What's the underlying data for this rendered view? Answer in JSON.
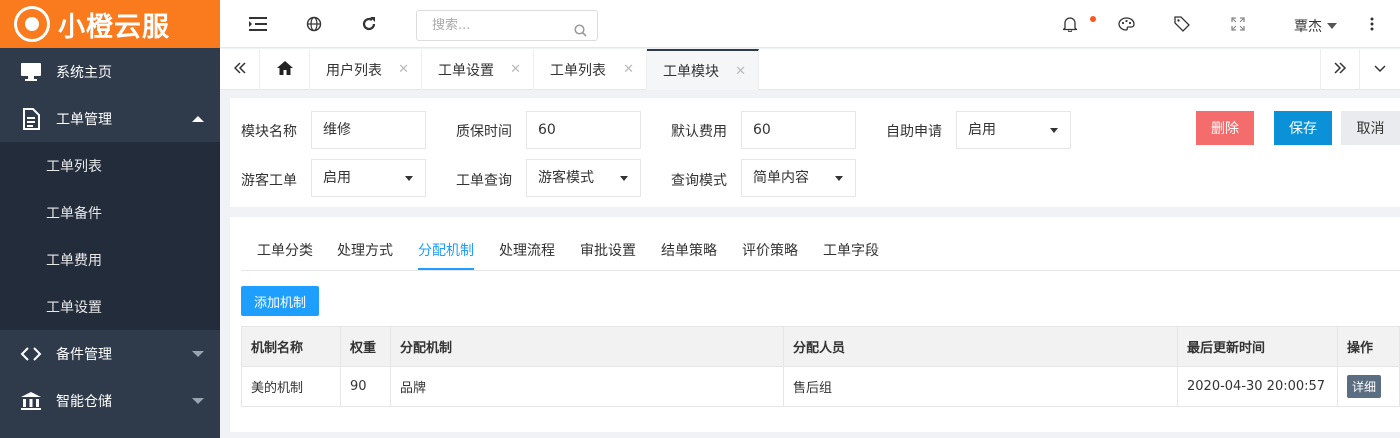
{
  "app": {
    "logo_text": "小橙云服"
  },
  "sidebar": {
    "items": [
      {
        "label": "系统主页",
        "icon": "monitor-icon"
      },
      {
        "label": "工单管理",
        "icon": "document-icon",
        "expanded": true,
        "children": [
          {
            "label": "工单列表"
          },
          {
            "label": "工单备件"
          },
          {
            "label": "工单费用"
          },
          {
            "label": "工单设置"
          }
        ]
      },
      {
        "label": "备件管理",
        "icon": "parts-icon"
      },
      {
        "label": "智能仓储",
        "icon": "warehouse-icon"
      }
    ]
  },
  "topbar": {
    "search_placeholder": "搜索...",
    "user_name": "覃杰",
    "icons": [
      "menu-toggle-icon",
      "globe-icon",
      "refresh-icon",
      "bell-icon",
      "palette-icon",
      "tag-icon",
      "fullscreen-icon",
      "more-vertical-icon"
    ]
  },
  "tabs": {
    "items": [
      {
        "label": "用户列表",
        "active": false
      },
      {
        "label": "工单设置",
        "active": false
      },
      {
        "label": "工单列表",
        "active": false
      },
      {
        "label": "工单模块",
        "active": true
      }
    ]
  },
  "form": {
    "module_name_label": "模块名称",
    "module_name_value": "维修",
    "warranty_label": "质保时间",
    "warranty_value": "60",
    "default_fee_label": "默认费用",
    "default_fee_value": "60",
    "self_apply_label": "自助申请",
    "self_apply_value": "启用",
    "guest_label": "游客工单",
    "guest_value": "启用",
    "query_label": "工单查询",
    "query_value": "游客模式",
    "query_mode_label": "查询模式",
    "query_mode_value": "简单内容",
    "delete_label": "删除",
    "save_label": "保存",
    "cancel_label": "取消"
  },
  "subtabs": {
    "items": [
      "工单分类",
      "处理方式",
      "分配机制",
      "处理流程",
      "审批设置",
      "结单策略",
      "评价策略",
      "工单字段"
    ],
    "active_index": 2
  },
  "table": {
    "add_label": "添加机制",
    "headers": [
      "机制名称",
      "权重",
      "分配机制",
      "分配人员",
      "最后更新时间",
      "操作"
    ],
    "rows": [
      {
        "name": "美的机制",
        "weight": "90",
        "mechanism": "品牌",
        "assignee": "售后组",
        "updated": "2020-04-30 20:00:57",
        "action": "详细"
      }
    ]
  },
  "colors": {
    "brand": "#fa7a1e",
    "sidebar": "#2f3a4b",
    "primary": "#1e9fff",
    "danger": "#f56c6c",
    "save": "#0a91d8"
  }
}
